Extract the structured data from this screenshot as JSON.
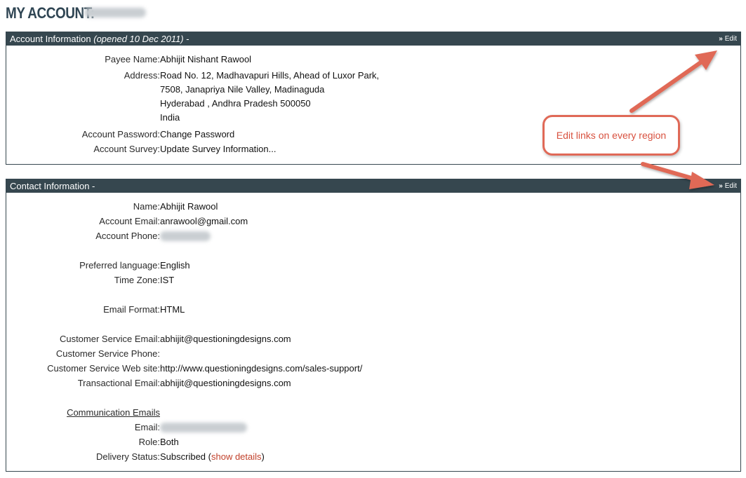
{
  "page": {
    "title": "MY ACCOUNT:"
  },
  "account_panel": {
    "header_title": "Account Information ",
    "header_opened": "(opened 10 Dec 2011)",
    "header_suffix": " -",
    "edit_label": "Edit",
    "rows": {
      "payee_label": "Payee Name:",
      "payee_value": "Abhijit Nishant Rawool",
      "address_label": "Address:",
      "address_line1": "Road No. 12, Madhavapuri Hills, Ahead of Luxor Park,",
      "address_line2": "7508, Janapriya Nile Valley, Madinaguda",
      "address_line3": "Hyderabad , Andhra Pradesh 500050",
      "address_line4": "India",
      "password_label": "Account Password:",
      "password_link": "Change Password",
      "survey_label": "Account Survey:",
      "survey_link": "Update Survey Information..."
    }
  },
  "contact_panel": {
    "header_title": "Contact Information -",
    "edit_label": "Edit",
    "rows": {
      "name_label": "Name:",
      "name_value": "Abhijit Rawool",
      "email_label": "Account Email:",
      "email_value": "anrawool@gmail.com",
      "phone_label": "Account Phone:",
      "language_label": "Preferred language:",
      "language_value": "English",
      "timezone_label": "Time Zone:",
      "timezone_value": "IST",
      "format_label": "Email Format:",
      "format_value": "HTML",
      "cs_email_label": "Customer Service Email:",
      "cs_email_value": "abhijit@questioningdesigns.com",
      "cs_phone_label": "Customer Service Phone:",
      "cs_web_label": "Customer Service Web site:",
      "cs_web_value": "http://www.questioningdesigns.com/sales-support/",
      "trans_email_label": "Transactional Email:",
      "trans_email_value": "abhijit@questioningdesigns.com",
      "comm_heading": "Communication Emails",
      "comm_email_label": "Email:",
      "role_label": "Role:",
      "role_value": "Both",
      "delivery_label": "Delivery Status:",
      "delivery_value": "Subscribed (",
      "delivery_link": "show details",
      "delivery_close": ")"
    }
  },
  "annotation": {
    "text": "Edit links on every region"
  },
  "colors": {
    "header_bg": "#36474f",
    "link": "#c1402a",
    "annotation": "#e06957"
  },
  "icons": {
    "edit": "double-chevron-right-icon"
  }
}
